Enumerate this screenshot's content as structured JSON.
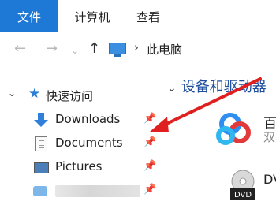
{
  "ribbon": {
    "tabs": [
      "文件",
      "计算机",
      "查看"
    ]
  },
  "nav": {
    "back": "←",
    "forward": "→",
    "dropdown": "⌄",
    "up": "↑"
  },
  "address": {
    "separator": "›",
    "path": "此电脑"
  },
  "sidebar": {
    "quick_access": {
      "label": "快速访问",
      "chevron": "⌄",
      "star": "★"
    },
    "items": [
      {
        "label": "Downloads",
        "icon": "download-arrow-icon",
        "pinned": true
      },
      {
        "label": "Documents",
        "icon": "document-icon",
        "pinned": true
      },
      {
        "label": "Pictures",
        "icon": "pictures-icon",
        "pinned": true
      },
      {
        "label": "",
        "icon": "cloud-folder-icon",
        "pinned": true,
        "blurred": true
      }
    ],
    "pin_glyph": "📌"
  },
  "main": {
    "section_header": "设备和驱动器",
    "section_chevron": "⌄",
    "devices": [
      {
        "name": "百",
        "sub": "双"
      },
      {
        "name": "DV",
        "icon_label": "DVD"
      }
    ]
  },
  "colors": {
    "accent": "#1e78d6",
    "annotation_arrow": "#e02020",
    "section_header": "#1f4e9d"
  }
}
